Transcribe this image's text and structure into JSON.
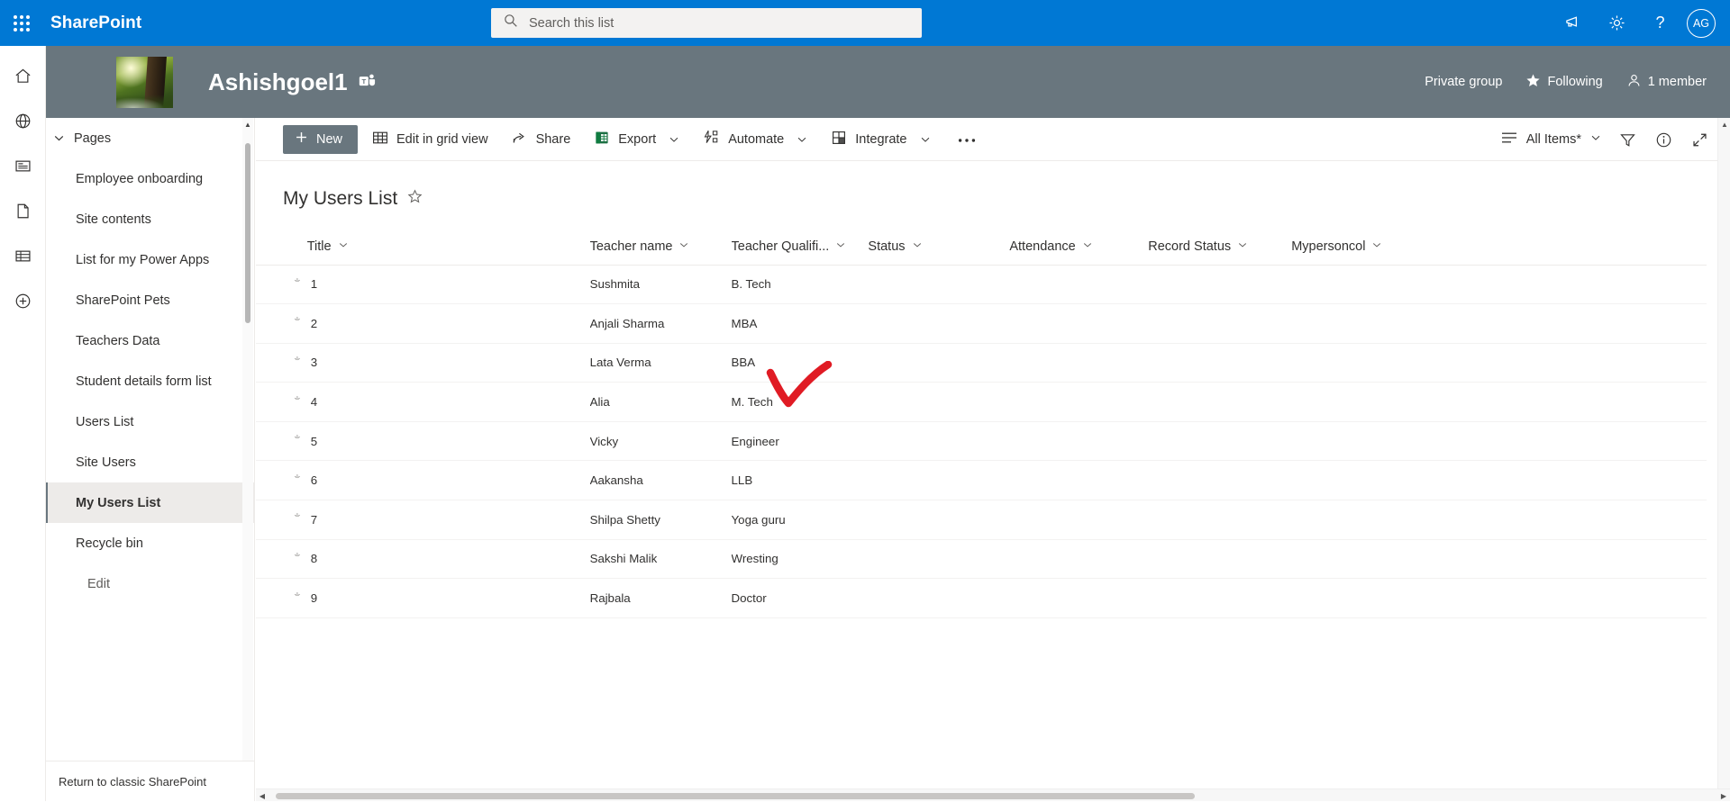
{
  "suite": {
    "brand": "SharePoint",
    "waffle_icon": "waffle-grid-icon",
    "search": {
      "placeholder": "Search this list",
      "value": "",
      "icon": "search-icon"
    },
    "icons": [
      {
        "name": "megaphone-icon",
        "label": "Announcements"
      },
      {
        "name": "gear-icon",
        "label": "Settings"
      },
      {
        "name": "help-icon",
        "label": "Help"
      }
    ],
    "avatar": {
      "initials": "AG"
    },
    "accent": "#0078d4"
  },
  "site": {
    "title": "Ashishgoel1",
    "teams_icon": "teams-icon",
    "thumbnail": "site-logo-nature-image",
    "privacy": "Private group",
    "following": "Following",
    "following_icon": "star-filled-icon",
    "members": "1 member",
    "members_icon": "person-icon",
    "header_color": "#69767e"
  },
  "rail": {
    "items": [
      {
        "name": "home-icon",
        "label": "Home"
      },
      {
        "name": "globe-icon",
        "label": "My sites"
      },
      {
        "name": "news-icon",
        "label": "News"
      },
      {
        "name": "page-icon",
        "label": "Pages"
      },
      {
        "name": "list-icon",
        "label": "Lists"
      },
      {
        "name": "plus-circle-icon",
        "label": "Create"
      }
    ]
  },
  "sidenav": {
    "group": {
      "label": "Pages",
      "chevron": "chevron-down-icon"
    },
    "items": [
      {
        "label": "Employee onboarding",
        "selected": false,
        "sub": false
      },
      {
        "label": "Site contents",
        "selected": false,
        "sub": false
      },
      {
        "label": "List for my Power Apps",
        "selected": false,
        "sub": false
      },
      {
        "label": "SharePoint Pets",
        "selected": false,
        "sub": false
      },
      {
        "label": "Teachers Data",
        "selected": false,
        "sub": false
      },
      {
        "label": "Student details form list",
        "selected": false,
        "sub": false
      },
      {
        "label": "Users List",
        "selected": false,
        "sub": false
      },
      {
        "label": "Site Users",
        "selected": false,
        "sub": false
      },
      {
        "label": "My Users List",
        "selected": true,
        "sub": false
      },
      {
        "label": "Recycle bin",
        "selected": false,
        "sub": false
      },
      {
        "label": "Edit",
        "selected": false,
        "sub": true
      }
    ],
    "footer": "Return to classic SharePoint"
  },
  "commandbar": {
    "new_label": "New",
    "new_icon": "plus-icon",
    "commands": [
      {
        "label": "Edit in grid view",
        "icon": "grid-view-icon",
        "chevron": false
      },
      {
        "label": "Share",
        "icon": "share-icon",
        "chevron": false
      },
      {
        "label": "Export",
        "icon": "excel-icon",
        "chevron": true
      },
      {
        "label": "Automate",
        "icon": "flow-icon",
        "chevron": true
      },
      {
        "label": "Integrate",
        "icon": "integrate-icon",
        "chevron": true
      }
    ],
    "overflow_label": "...",
    "overflow_icon": "ellipsis-icon",
    "view_name": "All Items*",
    "view_icon": "list-view-icon",
    "view_chevron": "chevron-down-icon",
    "right_icons": [
      {
        "name": "filter-icon",
        "label": "Filters"
      },
      {
        "name": "info-icon",
        "label": "Details"
      },
      {
        "name": "expand-icon",
        "label": "Full screen"
      }
    ]
  },
  "list": {
    "title": "My Users List",
    "favorite_icon": "star-outline-icon",
    "columns": [
      {
        "label": "Title",
        "chevron": "chevron-down-icon"
      },
      {
        "label": "Teacher name",
        "chevron": "chevron-down-icon"
      },
      {
        "label": "Teacher Qualifi...",
        "chevron": "chevron-down-icon"
      },
      {
        "label": "Status",
        "chevron": "chevron-down-icon"
      },
      {
        "label": "Attendance",
        "chevron": "chevron-down-icon"
      },
      {
        "label": "Record Status",
        "chevron": "chevron-down-icon"
      },
      {
        "label": "Mypersoncol",
        "chevron": "chevron-down-icon"
      }
    ],
    "rows": [
      {
        "title": "1",
        "teacher_name": "Sushmita",
        "qualification": "B. Tech",
        "status": "",
        "attendance": "",
        "record_status": "",
        "mypersoncol": ""
      },
      {
        "title": "2",
        "teacher_name": "Anjali Sharma",
        "qualification": "MBA",
        "status": "",
        "attendance": "",
        "record_status": "",
        "mypersoncol": ""
      },
      {
        "title": "3",
        "teacher_name": "Lata Verma",
        "qualification": "BBA",
        "status": "",
        "attendance": "",
        "record_status": "",
        "mypersoncol": ""
      },
      {
        "title": "4",
        "teacher_name": "Alia",
        "qualification": "M. Tech",
        "status": "",
        "attendance": "",
        "record_status": "",
        "mypersoncol": ""
      },
      {
        "title": "5",
        "teacher_name": "Vicky",
        "qualification": "Engineer",
        "status": "",
        "attendance": "",
        "record_status": "",
        "mypersoncol": ""
      },
      {
        "title": "6",
        "teacher_name": "Aakansha",
        "qualification": "LLB",
        "status": "",
        "attendance": "",
        "record_status": "",
        "mypersoncol": ""
      },
      {
        "title": "7",
        "teacher_name": "Shilpa Shetty",
        "qualification": "Yoga guru",
        "status": "",
        "attendance": "",
        "record_status": "",
        "mypersoncol": ""
      },
      {
        "title": "8",
        "teacher_name": "Sakshi Malik",
        "qualification": "Wresting",
        "status": "",
        "attendance": "",
        "record_status": "",
        "mypersoncol": ""
      },
      {
        "title": "9",
        "teacher_name": "Rajbala",
        "qualification": "Doctor",
        "status": "",
        "attendance": "",
        "record_status": "",
        "mypersoncol": ""
      }
    ]
  },
  "annotation": {
    "shape": "red-checkmark",
    "color": "#e01b24"
  }
}
